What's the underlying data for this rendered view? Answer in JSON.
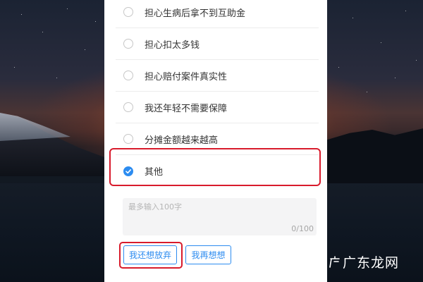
{
  "options": [
    {
      "label": "担心生病后拿不到互助金",
      "checked": false
    },
    {
      "label": "担心扣太多钱",
      "checked": false
    },
    {
      "label": "担心赔付案件真实性",
      "checked": false
    },
    {
      "label": "我还年轻不需要保障",
      "checked": false
    },
    {
      "label": "分摊金额越来越高",
      "checked": false
    },
    {
      "label": "其他",
      "checked": true
    }
  ],
  "feedback": {
    "placeholder": "最多输入100字",
    "counter": "0/100"
  },
  "buttons": {
    "give_up": "我还想放弃",
    "rethink": "我再想想"
  },
  "watermark": "广东龙网",
  "colors": {
    "accent": "#2d8cf0",
    "highlight": "#d81b2c"
  }
}
